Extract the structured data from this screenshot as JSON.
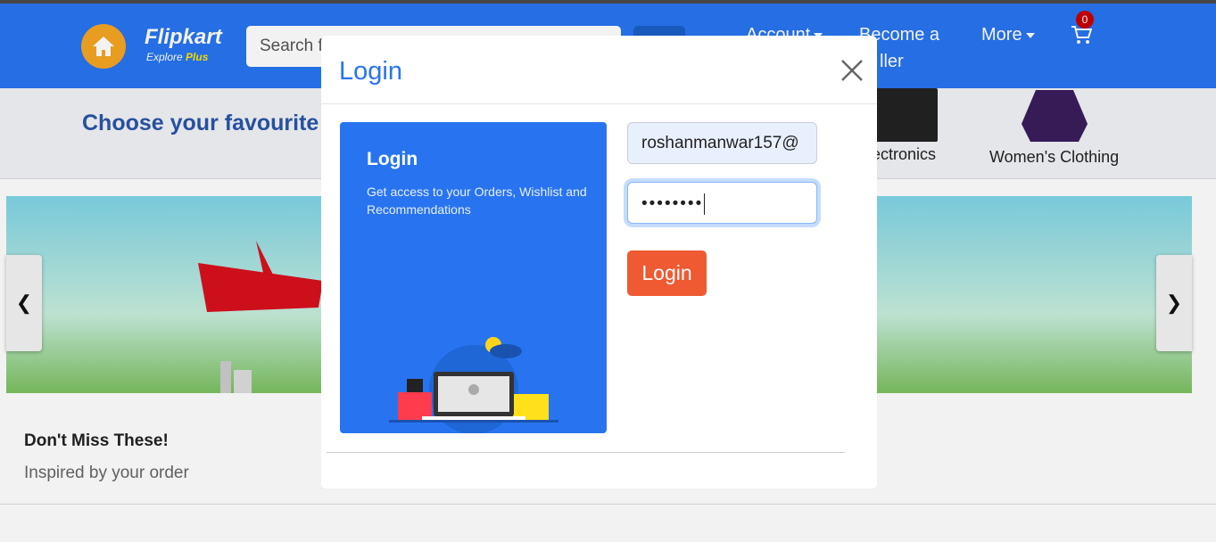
{
  "header": {
    "brand": "Flipkart",
    "brand_sub_prefix": "Explore",
    "brand_sub_plus": "Plus",
    "search_placeholder_visible": "Search f",
    "account_label": "Account",
    "become_seller_line1": "Become a",
    "become_seller_line2": "ller",
    "more_label": "More",
    "cart_count": "0"
  },
  "categories": {
    "heading": "Choose your favourite c",
    "items": [
      {
        "label": "ectronics",
        "icon": "ssd-icon"
      },
      {
        "label": "Women's Clothing",
        "icon": "jacket-icon"
      }
    ]
  },
  "section": {
    "title": "Don't Miss These!",
    "subtitle": "Inspired by your order"
  },
  "modal": {
    "title": "Login",
    "promo_title": "Login",
    "promo_text": "Get access to your Orders, Wishlist and Recommendations",
    "email_value": "roshanmanwar157@",
    "password_mask": "••••••••",
    "submit_label": "Login"
  },
  "colors": {
    "brand_blue": "#2874f0",
    "login_button": "#ef5a32"
  }
}
